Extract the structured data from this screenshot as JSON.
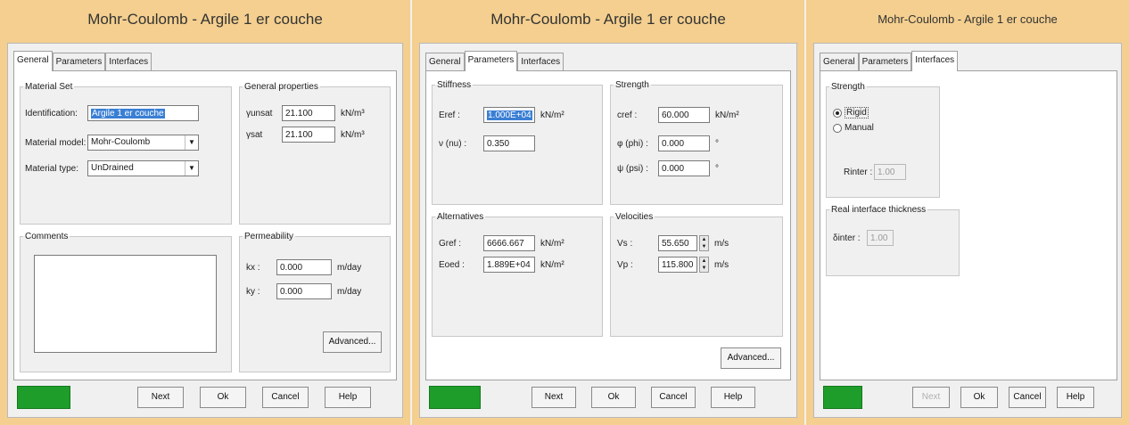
{
  "dialogs": [
    {
      "title": "Mohr-Coulomb - Argile 1 er couche",
      "tabs": [
        "General",
        "Parameters",
        "Interfaces"
      ],
      "active_tab": "General",
      "material_set": {
        "legend": "Material Set",
        "identification_label": "Identification:",
        "identification_value": "Argile 1 er couche",
        "model_label": "Material model:",
        "model_value": "Mohr-Coulomb",
        "type_label": "Material type:",
        "type_value": "UnDrained"
      },
      "general_properties": {
        "legend": "General properties",
        "unsat_label": "γunsat",
        "unsat_value": "21.100",
        "unsat_unit": "kN/m³",
        "sat_label": "γsat",
        "sat_value": "21.100",
        "sat_unit": "kN/m³"
      },
      "comments": {
        "legend": "Comments",
        "value": ""
      },
      "permeability": {
        "legend": "Permeability",
        "kx_label": "kx :",
        "kx_value": "0.000",
        "kx_unit": "m/day",
        "ky_label": "ky :",
        "ky_value": "0.000",
        "ky_unit": "m/day",
        "advanced_label": "Advanced..."
      },
      "buttons": {
        "next": "Next",
        "ok": "Ok",
        "cancel": "Cancel",
        "help": "Help"
      }
    },
    {
      "title": "Mohr-Coulomb - Argile 1 er couche",
      "tabs": [
        "General",
        "Parameters",
        "Interfaces"
      ],
      "active_tab": "Parameters",
      "stiffness": {
        "legend": "Stiffness",
        "eref_label": "Eref :",
        "eref_value": "1.000E+04",
        "eref_unit": "kN/m²",
        "nu_label": "ν (nu) :",
        "nu_value": "0.350"
      },
      "strength": {
        "legend": "Strength",
        "cref_label": "cref :",
        "cref_value": "60.000",
        "cref_unit": "kN/m²",
        "phi_label": "φ (phi) :",
        "phi_value": "0.000",
        "phi_unit": "°",
        "psi_label": "ψ (psi) :",
        "psi_value": "0.000",
        "psi_unit": "°"
      },
      "alternatives": {
        "legend": "Alternatives",
        "gref_label": "Gref :",
        "gref_value": "6666.667",
        "gref_unit": "kN/m²",
        "eoed_label": "Eoed :",
        "eoed_value": "1.889E+04",
        "eoed_unit": "kN/m²"
      },
      "velocities": {
        "legend": "Velocities",
        "vs_label": "Vs :",
        "vs_value": "55.650",
        "vs_unit": "m/s",
        "vp_label": "Vp :",
        "vp_value": "115.800",
        "vp_unit": "m/s"
      },
      "advanced_label": "Advanced...",
      "buttons": {
        "next": "Next",
        "ok": "Ok",
        "cancel": "Cancel",
        "help": "Help"
      }
    },
    {
      "title": "Mohr-Coulomb - Argile 1 er couche",
      "tabs": [
        "General",
        "Parameters",
        "Interfaces"
      ],
      "active_tab": "Interfaces",
      "strength": {
        "legend": "Strength",
        "rigid_label": "Rigid",
        "manual_label": "Manual",
        "selected": "Rigid",
        "rinter_label": "Rinter :",
        "rinter_value": "1.00"
      },
      "thickness": {
        "legend": "Real interface thickness",
        "label": "δinter :",
        "value": "1.00"
      },
      "buttons": {
        "next": "Next",
        "ok": "Ok",
        "cancel": "Cancel",
        "help": "Help"
      }
    }
  ],
  "colors": {
    "frame": "#f4cf8f",
    "status_green": "#1e9d2a",
    "selection": "#3a7fd4"
  }
}
